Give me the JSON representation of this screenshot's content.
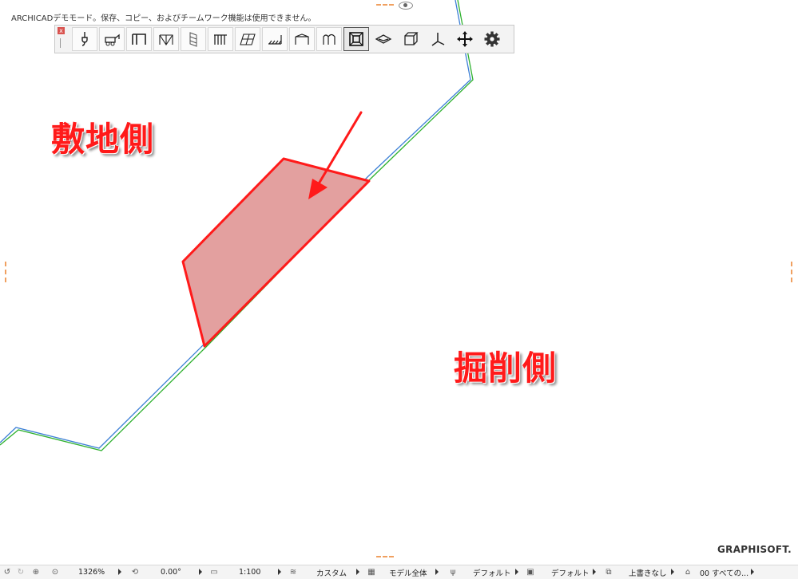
{
  "demo_banner": "ARCHICADデモモード。保存、コピー、およびチームワーク機能は使用できません。",
  "toolbar": {
    "close_label": "x",
    "buttons": [
      {
        "icon": "crane-hook-icon"
      },
      {
        "icon": "excavator-icon"
      },
      {
        "icon": "wall-frame-icon"
      },
      {
        "icon": "braced-frame-icon"
      },
      {
        "icon": "column-cage-icon"
      },
      {
        "icon": "railing-icon"
      },
      {
        "icon": "slab-grid-icon"
      },
      {
        "icon": "stair-hatch-icon"
      },
      {
        "icon": "roof-icon"
      },
      {
        "icon": "curtain-icon"
      },
      {
        "icon": "frame-box-icon"
      },
      {
        "icon": "mesh-icon"
      },
      {
        "icon": "cube-icon"
      },
      {
        "icon": "axis-icon"
      },
      {
        "icon": "move-arrows-icon"
      },
      {
        "icon": "gear-icon"
      }
    ]
  },
  "labels": {
    "site_side": "敷地側",
    "excavation_side": "掘削側"
  },
  "brand": "GRAPHISOFT.",
  "status": {
    "zoom": "1326%",
    "angle": "0.00°",
    "scale": "1:100",
    "layer": "カスタム",
    "model": "モデル全体",
    "pen1": "デフォルト",
    "pen2": "デフォルト",
    "override": "上書きなし",
    "story": "00 すべての..."
  },
  "colors": {
    "accent_red": "#ff1a1a",
    "polygon_fill": "#e3a09f",
    "line_blue": "#3c7fd6",
    "line_green": "#2fb12f"
  }
}
